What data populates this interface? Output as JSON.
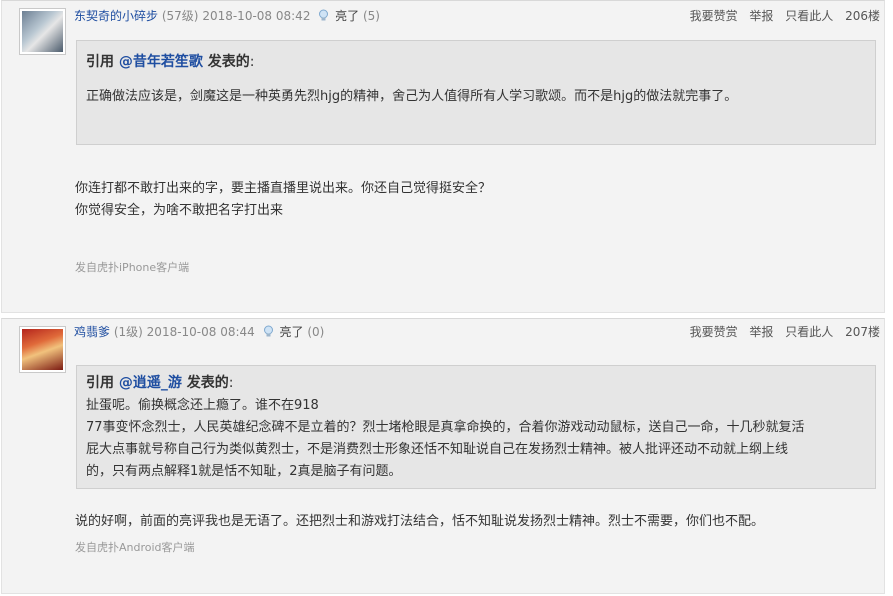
{
  "posts": [
    {
      "username": "东契奇的小碎步",
      "level": "(57级)",
      "timestamp": "2018-10-08 08:42",
      "like_label": "亮了",
      "like_count": "(5)",
      "actions": [
        "我要赞赏",
        "举报",
        "只看此人"
      ],
      "floor": "206楼",
      "quote": {
        "prefix": "引用 ",
        "quoted_user": "@昔年若笙歌",
        "suffix": " 发表的",
        "colon": ":",
        "lines": [
          "正确做法应该是，剑魔这是一种英勇先烈hjg的精神，舍己为人值得所有人学习歌颂。而不是hjg的做法就完事了。"
        ]
      },
      "reply_lines": [
        "你连打都不敢打出来的字，要主播直播里说出来。你还自己觉得挺安全？",
        "你觉得安全，为啥不敢把名字打出来"
      ],
      "source": "发自虎扑iPhone客户端"
    },
    {
      "username": "鸡翡爹",
      "level": "(1级)",
      "timestamp": "2018-10-08 08:44",
      "like_label": "亮了",
      "like_count": "(0)",
      "actions": [
        "我要赞赏",
        "举报",
        "只看此人"
      ],
      "floor": "207楼",
      "quote": {
        "prefix": "引用 ",
        "quoted_user": "@逍遥_游",
        "suffix": " 发表的",
        "colon": ":",
        "lines": [
          "扯蛋呢。偷换概念还上瘾了。谁不在918",
          "77事变怀念烈士，人民英雄纪念碑不是立着的？烈士堵枪眼是真拿命换的，合着你游戏动动鼠标，送自己一命，十几秒就复活",
          "屁大点事就号称自己行为类似黄烈士，不是消费烈士形象还恬不知耻说自己在发扬烈士精神。被人批评还动不动就上纲上线",
          "的，只有两点解释1就是恬不知耻，2真是脑子有问题。"
        ]
      },
      "reply_lines": [
        "说的好啊，前面的亮评我也是无语了。还把烈士和游戏打法结合，恬不知耻说发扬烈士精神。烈士不需要，你们也不配。"
      ],
      "source": "发自虎扑Android客户端"
    }
  ],
  "colors": {
    "username": "#1f4ea1",
    "post_bg": "#f3f3f3",
    "quote_bg": "#e6e6e6",
    "meta": "#888888"
  },
  "icons": {
    "like": "lightbulb-icon"
  }
}
